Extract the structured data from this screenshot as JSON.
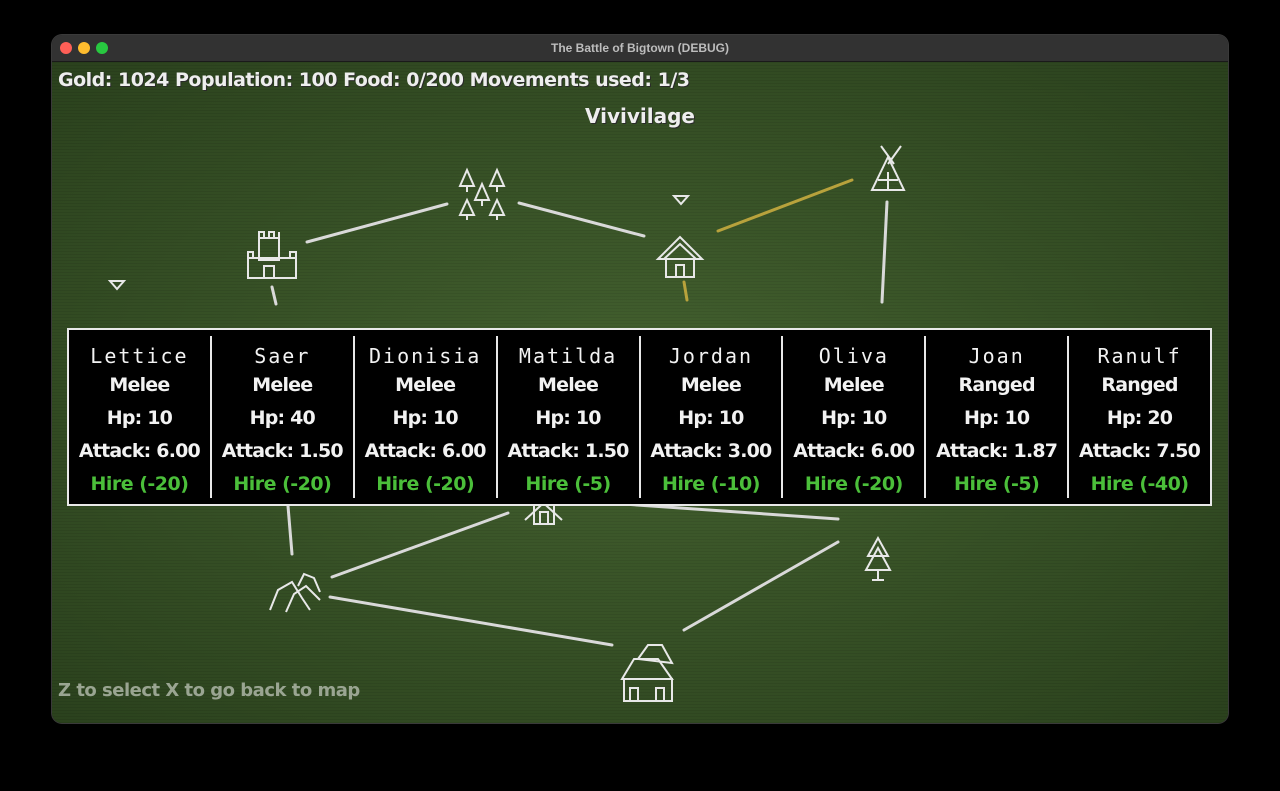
{
  "window": {
    "title": "The Battle of Bigtown (DEBUG)"
  },
  "colors": {
    "ground": "#3d5a2b",
    "road": "#d9d9d9",
    "selected_road": "#b8a23c",
    "hire": "#4bbf3a",
    "text": "#f2f2f2"
  },
  "hud": {
    "status": "Gold: 1024 Population: 100 Food: 0/200 Movements used: 1/3"
  },
  "village": {
    "name": "Vivivilage"
  },
  "map": {
    "icons": [
      "castle-icon",
      "forest-icon",
      "house-icon",
      "tent-icon",
      "windmill-icon",
      "pine-tree-icon",
      "rocks-icon",
      "manor-icon"
    ]
  },
  "units": [
    {
      "name": "Lettice",
      "type": "Melee",
      "hp": "Hp: 10",
      "attack": "Attack: 6.00",
      "hire": "Hire (-20)"
    },
    {
      "name": "Saer",
      "type": "Melee",
      "hp": "Hp: 40",
      "attack": "Attack: 1.50",
      "hire": "Hire (-20)"
    },
    {
      "name": "Dionisia",
      "type": "Melee",
      "hp": "Hp: 10",
      "attack": "Attack: 6.00",
      "hire": "Hire (-20)"
    },
    {
      "name": "Matilda",
      "type": "Melee",
      "hp": "Hp: 10",
      "attack": "Attack: 1.50",
      "hire": "Hire (-5)"
    },
    {
      "name": "Jordan",
      "type": "Melee",
      "hp": "Hp: 10",
      "attack": "Attack: 3.00",
      "hire": "Hire (-10)"
    },
    {
      "name": "Oliva",
      "type": "Melee",
      "hp": "Hp: 10",
      "attack": "Attack: 6.00",
      "hire": "Hire (-20)"
    },
    {
      "name": "Joan",
      "type": "Ranged",
      "hp": "Hp: 10",
      "attack": "Attack: 1.87",
      "hire": "Hire (-5)"
    },
    {
      "name": "Ranulf",
      "type": "Ranged",
      "hp": "Hp: 20",
      "attack": "Attack: 7.50",
      "hire": "Hire (-40)"
    }
  ],
  "footer": {
    "hint": "Z to select X to go back to map"
  }
}
